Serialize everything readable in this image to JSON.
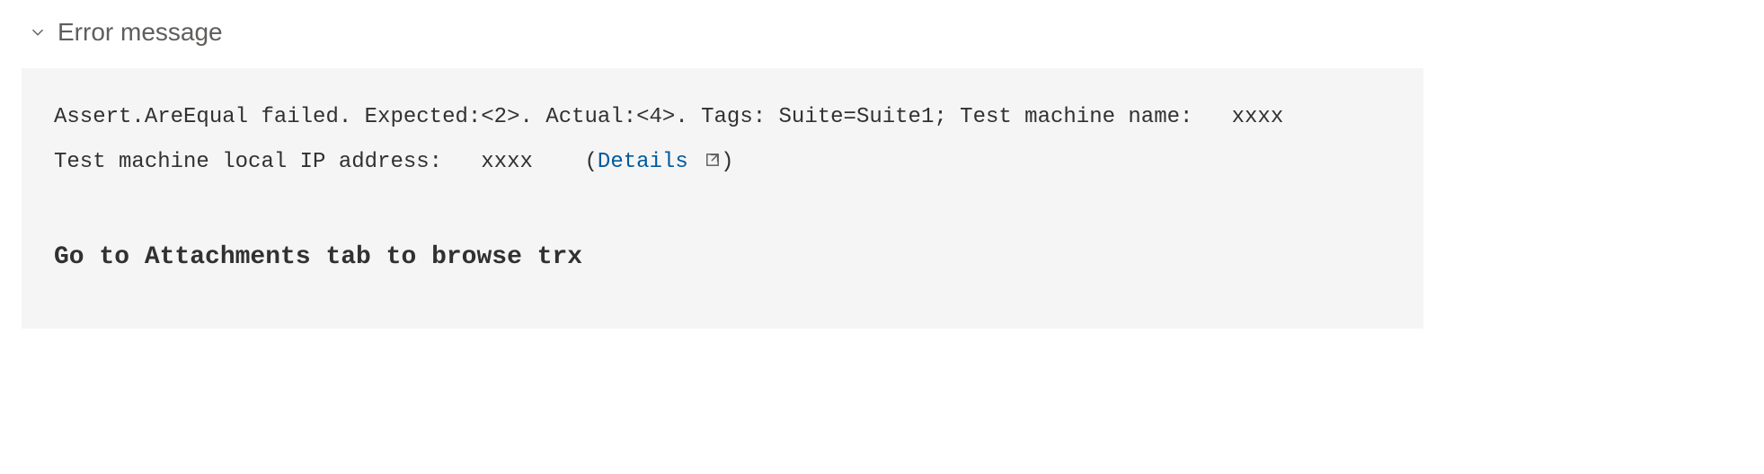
{
  "section": {
    "title": "Error message"
  },
  "error": {
    "line1_pre": "Assert.AreEqual failed. Expected:<2>. Actual:<4>. Tags: Suite=Suite1; Test machine name:",
    "line1_masked": "xxxx",
    "line2_pre": "Test machine local IP address:",
    "line2_masked": "xxxx",
    "paren_open": "(",
    "details_label": "Details",
    "paren_close": ")",
    "bold_message": "Go to Attachments tab to browse trx"
  }
}
